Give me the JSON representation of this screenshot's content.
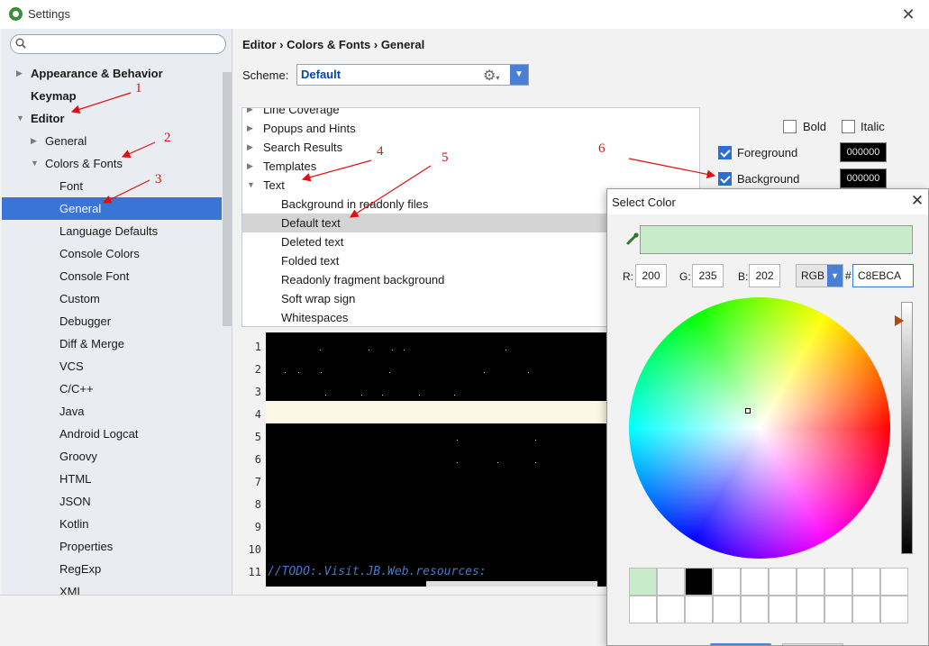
{
  "window": {
    "title": "Settings"
  },
  "left": {
    "search_placeholder": "",
    "tree": [
      {
        "label": "Appearance & Behavior",
        "indent": 0,
        "arrow": "▶",
        "bold": true,
        "selected": false
      },
      {
        "label": "Keymap",
        "indent": 0,
        "arrow": "",
        "bold": true,
        "selected": false
      },
      {
        "label": "Editor",
        "indent": 0,
        "arrow": "▼",
        "bold": true,
        "selected": false
      },
      {
        "label": "General",
        "indent": 1,
        "arrow": "▶",
        "bold": false,
        "selected": false
      },
      {
        "label": "Colors & Fonts",
        "indent": 1,
        "arrow": "▼",
        "bold": false,
        "selected": false
      },
      {
        "label": "Font",
        "indent": 2,
        "arrow": "",
        "bold": false,
        "selected": false
      },
      {
        "label": "General",
        "indent": 2,
        "arrow": "",
        "bold": false,
        "selected": true
      },
      {
        "label": "Language Defaults",
        "indent": 2,
        "arrow": "",
        "bold": false,
        "selected": false
      },
      {
        "label": "Console Colors",
        "indent": 2,
        "arrow": "",
        "bold": false,
        "selected": false
      },
      {
        "label": "Console Font",
        "indent": 2,
        "arrow": "",
        "bold": false,
        "selected": false
      },
      {
        "label": "Custom",
        "indent": 2,
        "arrow": "",
        "bold": false,
        "selected": false
      },
      {
        "label": "Debugger",
        "indent": 2,
        "arrow": "",
        "bold": false,
        "selected": false
      },
      {
        "label": "Diff & Merge",
        "indent": 2,
        "arrow": "",
        "bold": false,
        "selected": false
      },
      {
        "label": "VCS",
        "indent": 2,
        "arrow": "",
        "bold": false,
        "selected": false
      },
      {
        "label": "C/C++",
        "indent": 2,
        "arrow": "",
        "bold": false,
        "selected": false
      },
      {
        "label": "Java",
        "indent": 2,
        "arrow": "",
        "bold": false,
        "selected": false
      },
      {
        "label": "Android Logcat",
        "indent": 2,
        "arrow": "",
        "bold": false,
        "selected": false
      },
      {
        "label": "Groovy",
        "indent": 2,
        "arrow": "",
        "bold": false,
        "selected": false
      },
      {
        "label": "HTML",
        "indent": 2,
        "arrow": "",
        "bold": false,
        "selected": false
      },
      {
        "label": "JSON",
        "indent": 2,
        "arrow": "",
        "bold": false,
        "selected": false
      },
      {
        "label": "Kotlin",
        "indent": 2,
        "arrow": "",
        "bold": false,
        "selected": false
      },
      {
        "label": "Properties",
        "indent": 2,
        "arrow": "",
        "bold": false,
        "selected": false
      },
      {
        "label": "RegExp",
        "indent": 2,
        "arrow": "",
        "bold": false,
        "selected": false
      },
      {
        "label": "XML",
        "indent": 2,
        "arrow": "",
        "bold": false,
        "selected": false
      }
    ]
  },
  "right": {
    "breadcrumb": "Editor › Colors & Fonts › General",
    "scheme_label": "Scheme:",
    "scheme_value": "Default",
    "options": [
      {
        "label": "Line Coverage",
        "arrow": "▶",
        "indent": 0,
        "selected": false
      },
      {
        "label": "Popups and Hints",
        "arrow": "▶",
        "indent": 0,
        "selected": false
      },
      {
        "label": "Search Results",
        "arrow": "▶",
        "indent": 0,
        "selected": false
      },
      {
        "label": "Templates",
        "arrow": "▶",
        "indent": 0,
        "selected": false
      },
      {
        "label": "Text",
        "arrow": "▼",
        "indent": 0,
        "selected": false
      },
      {
        "label": "Background in readonly files",
        "arrow": "",
        "indent": 1,
        "selected": false
      },
      {
        "label": "Default text",
        "arrow": "",
        "indent": 1,
        "selected": true
      },
      {
        "label": "Deleted text",
        "arrow": "",
        "indent": 1,
        "selected": false
      },
      {
        "label": "Folded text",
        "arrow": "",
        "indent": 1,
        "selected": false
      },
      {
        "label": "Readonly fragment background",
        "arrow": "",
        "indent": 1,
        "selected": false
      },
      {
        "label": "Soft wrap sign",
        "arrow": "",
        "indent": 1,
        "selected": false
      },
      {
        "label": "Whitespaces",
        "arrow": "",
        "indent": 1,
        "selected": false
      }
    ],
    "attributes": {
      "bold_label": "Bold",
      "bold_checked": false,
      "italic_label": "Italic",
      "italic_checked": false,
      "foreground_label": "Foreground",
      "foreground_checked": true,
      "foreground_value": "000000",
      "background_label": "Background",
      "background_checked": true,
      "background_value": "000000"
    },
    "preview": {
      "line_numbers": [
        "1",
        "2",
        "3",
        "4",
        "5",
        "6",
        "7",
        "8",
        "9",
        "10",
        "11"
      ],
      "line11_text": "//TODO:.Visit.JB.Web.resources:"
    }
  },
  "color_dialog": {
    "title": "Select Color",
    "preview_color": "#c8ebca",
    "r_label": "R:",
    "r_value": "200",
    "g_label": "G:",
    "g_value": "235",
    "b_label": "B:",
    "b_value": "202",
    "mode": "RGB",
    "hash": "#",
    "hex_value": "C8EBCA",
    "recent_colors": [
      "#c8ebca",
      "#f2f2f2",
      "#000000",
      "#ffffff",
      "#ffffff",
      "#ffffff",
      "#ffffff",
      "#ffffff",
      "#ffffff",
      "#ffffff",
      "#ffffff",
      "#ffffff",
      "#ffffff",
      "#ffffff",
      "#ffffff",
      "#ffffff",
      "#ffffff",
      "#ffffff",
      "#ffffff",
      "#ffffff"
    ]
  },
  "annotations": [
    "1",
    "2",
    "3",
    "4",
    "5",
    "6"
  ]
}
